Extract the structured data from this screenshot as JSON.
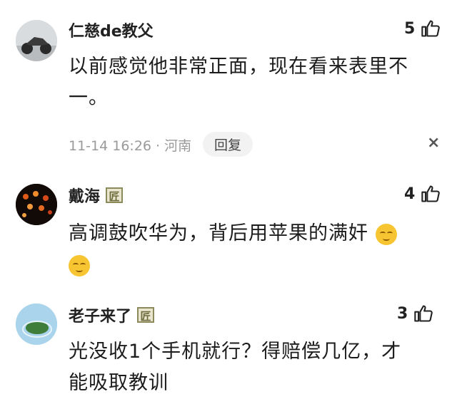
{
  "comments": [
    {
      "username": "仁慈de教父",
      "likes": "5",
      "text_line1": "以前感觉他非常正面，现在看来表里不",
      "text_line2": "一。",
      "meta": "11-14 16:26 · 河南",
      "reply_label": "回复",
      "close_label": "×"
    },
    {
      "username": "戴海",
      "likes": "4",
      "text_line1": "高调鼓吹华为，背后用苹果的满奸"
    },
    {
      "username": "老子来了",
      "likes": "3",
      "text_line1": "光没收1个手机就行？得赔偿几亿，才",
      "text_line2": "能吸取教训"
    }
  ],
  "badge_label": "匠",
  "icons": {
    "like": "thumbs-up-icon",
    "emoji": "smirk-emoji-icon"
  }
}
